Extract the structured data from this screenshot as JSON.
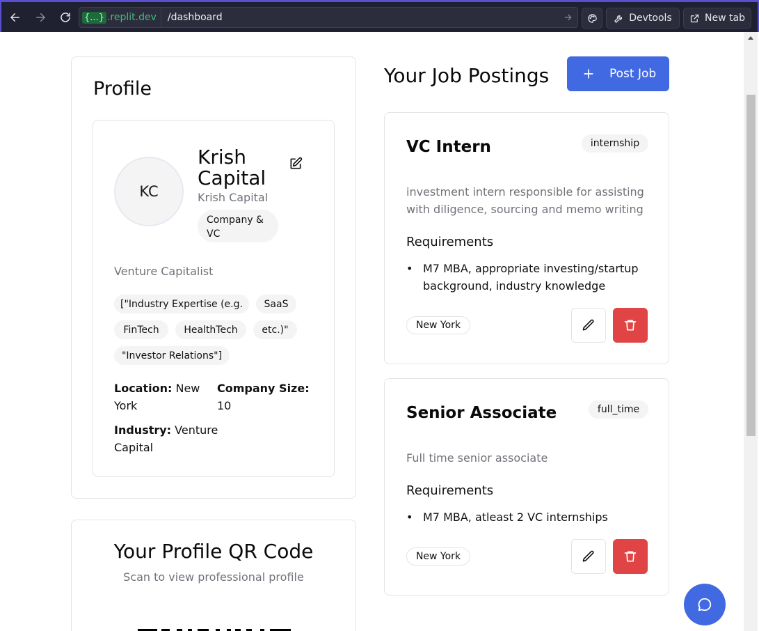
{
  "browser": {
    "url_badge": "{...}",
    "url_host": ".replit.dev",
    "url_path": "/dashboard",
    "devtools_label": "Devtools",
    "new_tab_label": "New tab"
  },
  "profile": {
    "section_title": "Profile",
    "avatar_initials": "KC",
    "company_name": "Krish Capital",
    "company_subtitle": "Krish Capital",
    "company_type": "Company & VC",
    "role": "Venture Capitalist",
    "tags": [
      "[\"Industry Expertise (e.g.",
      "SaaS",
      "FinTech",
      "HealthTech",
      "etc.)\"",
      "\"Investor Relations\"]"
    ],
    "location_label": "Location:",
    "location_value": "New York",
    "company_size_label": "Company Size:",
    "company_size_value": "10",
    "industry_label": "Industry:",
    "industry_value": "Venture Capital"
  },
  "qr": {
    "title": "Your Profile QR Code",
    "subtitle": "Scan to view professional profile"
  },
  "jobs": {
    "section_title": "Your Job Postings",
    "post_button_label": "Post Job",
    "requirements_heading": "Requirements",
    "postings": [
      {
        "title": "VC Intern",
        "type": "internship",
        "description": "investment intern responsible for assisting with diligence, sourcing and memo writing",
        "requirements": [
          "M7 MBA, appropriate investing/startup background, industry knowledge"
        ],
        "location": "New York"
      },
      {
        "title": "Senior Associate",
        "type": "full_time",
        "description": "Full time senior associate",
        "requirements": [
          "M7 MBA, atleast 2 VC internships"
        ],
        "location": "New York"
      }
    ]
  },
  "colors": {
    "accent": "#4169e1",
    "danger": "#e04444",
    "chrome_bg": "#1f2130",
    "url_green": "#3fc07a"
  },
  "icons": {
    "back": "arrow-left-icon",
    "forward": "arrow-right-icon",
    "reload": "reload-icon",
    "palette": "palette-icon",
    "devtools": "wrench-icon",
    "new_tab": "external-link-icon",
    "edit_profile": "edit-square-icon",
    "post_job": "plus-icon",
    "edit_job": "pencil-icon",
    "delete_job": "trash-icon",
    "chat": "chat-bubble-icon"
  }
}
